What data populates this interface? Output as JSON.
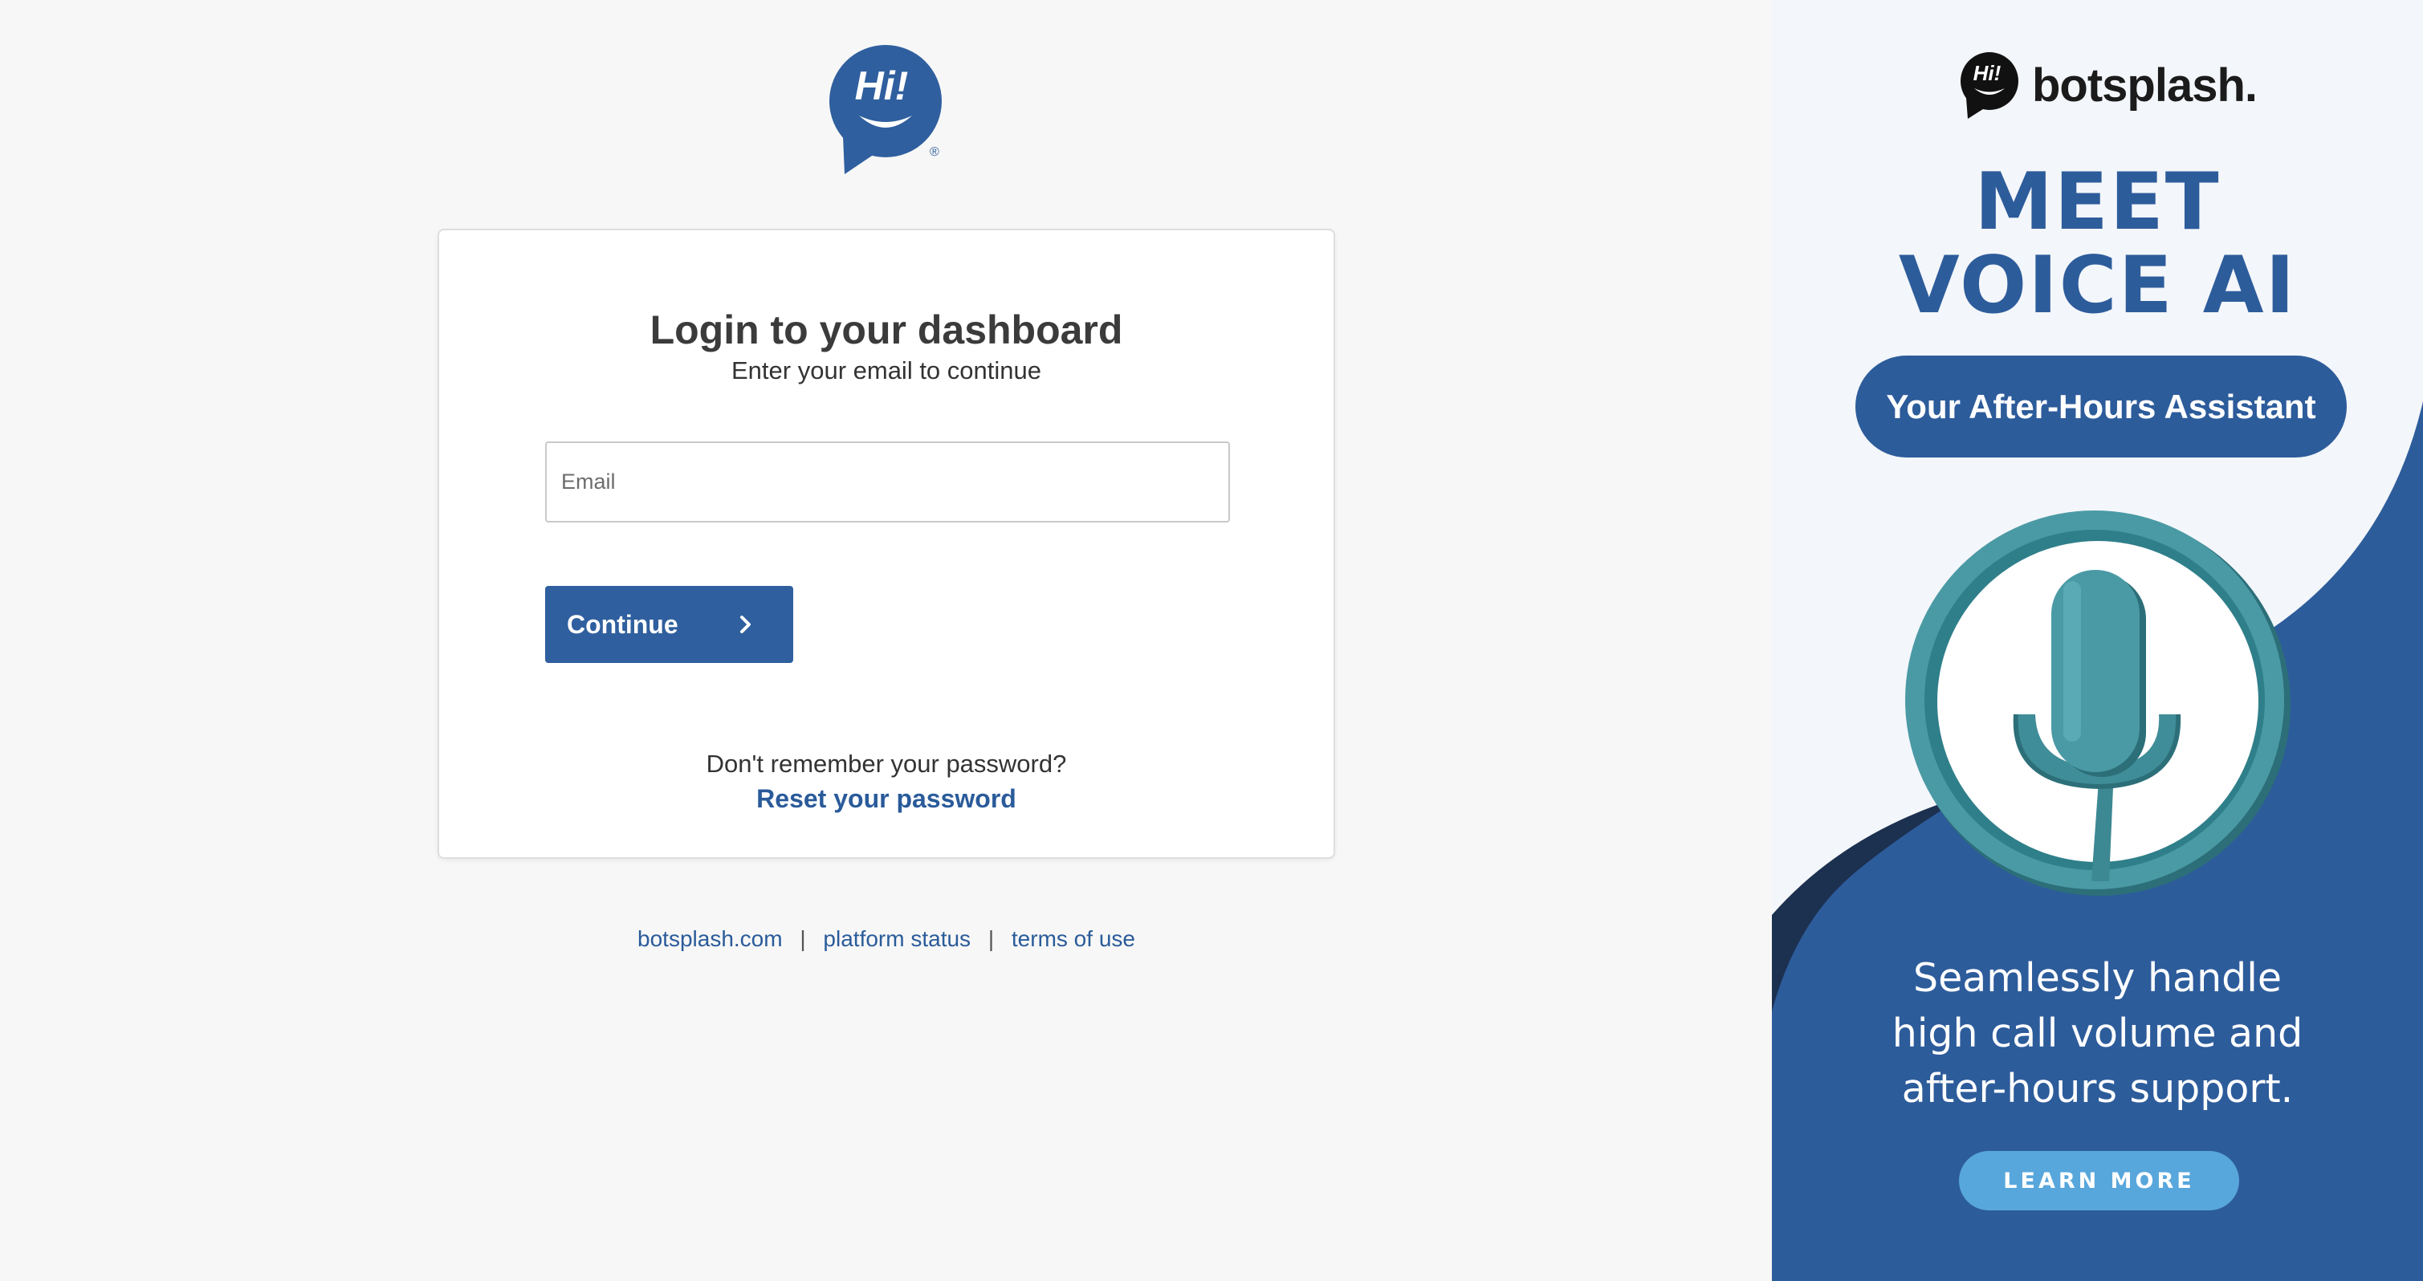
{
  "brand": {
    "logo_text": "Hi!",
    "logo_mark": "®",
    "logo_color": "#2f5f9e"
  },
  "login": {
    "title": "Login to your dashboard",
    "subtitle": "Enter your email to continue",
    "email_placeholder": "Email",
    "email_value": "",
    "continue_label": "Continue",
    "forgot_text": "Don't remember your password?",
    "reset_link": "Reset your password",
    "accent": "#2f5f9e"
  },
  "footer": {
    "links": [
      "botsplash.com",
      "platform status",
      "terms of use"
    ],
    "separator": "|"
  },
  "ad": {
    "brand_name": "botsplash.",
    "headline_line1": "MEET",
    "headline_line2": "VOICE AI",
    "pill_text": "Your After-Hours Assistant",
    "body_line1": "Seamlessly handle",
    "body_line2": "high call volume and",
    "body_line3": "after-hours support.",
    "cta_label": "LEARN MORE",
    "colors": {
      "primary": "#2d5c9b",
      "dark": "#1c3050",
      "teal": "#3f8d98",
      "cta": "#58a7dc"
    }
  }
}
